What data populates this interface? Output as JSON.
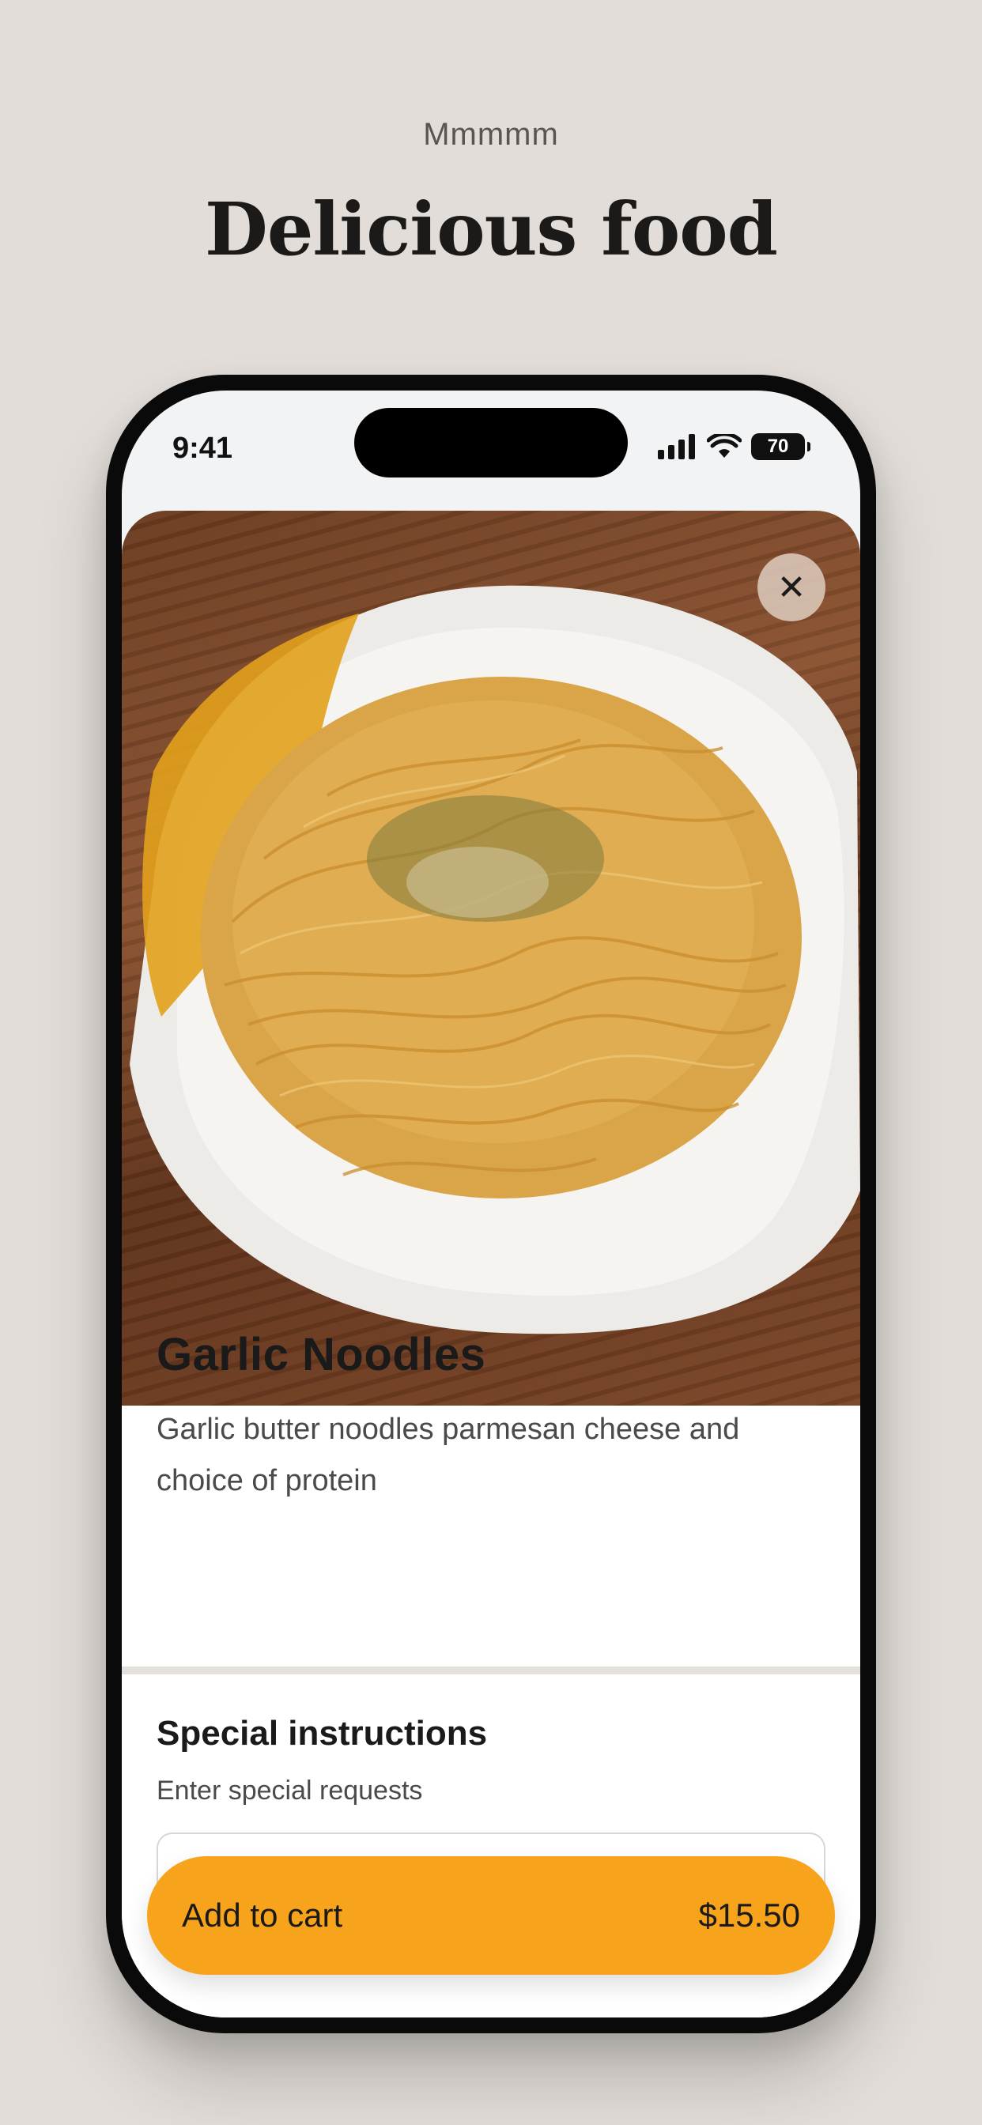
{
  "header": {
    "eyebrow": "Mmmmm",
    "title": "Delicious food"
  },
  "status_bar": {
    "time": "9:41",
    "battery": "70",
    "icons": [
      "signal-icon",
      "wifi-icon",
      "battery-icon"
    ]
  },
  "item": {
    "name": "Garlic Noodles",
    "description": "Garlic butter noodles parmesan cheese and choice of protein",
    "image": "garlic-noodles-photo"
  },
  "instructions": {
    "title": "Special instructions",
    "subtitle": "Enter special requests",
    "value": ""
  },
  "cart_button": {
    "label": "Add to cart",
    "price": "$15.50"
  },
  "colors": {
    "background": "#e2ddd8",
    "accent": "#f7a31b",
    "text": "#1a1a1a"
  }
}
